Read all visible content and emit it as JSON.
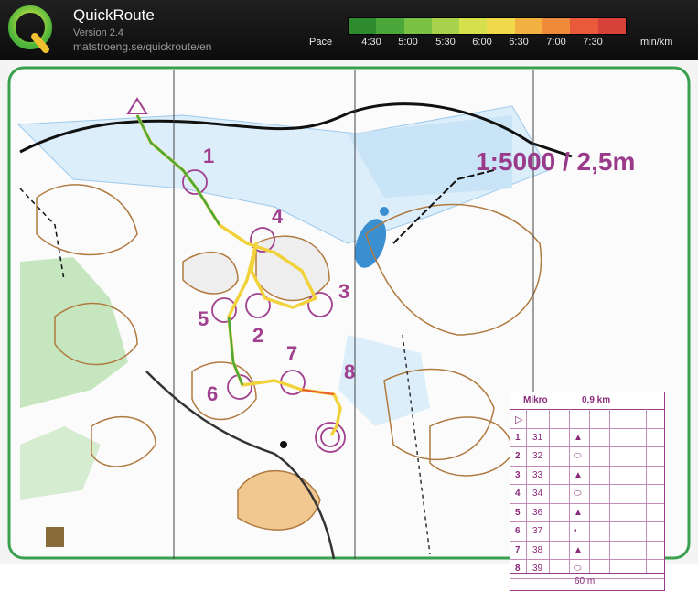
{
  "app": {
    "title": "QuickRoute",
    "version": "Version 2.4",
    "url": "matstroeng.se/quickroute/en"
  },
  "pace_legend": {
    "label": "Pace",
    "unit": "min/km",
    "ticks": [
      "4:30",
      "5:00",
      "5:30",
      "6:00",
      "6:30",
      "7:00",
      "7:30"
    ],
    "gradient_colors": [
      "#2e8b2e",
      "#4aa83a",
      "#79c244",
      "#a8d24c",
      "#d6e04c",
      "#f0d94a",
      "#f2b140",
      "#ef8a3a",
      "#e85a3a",
      "#d8403a"
    ]
  },
  "map": {
    "scale_text": "1:5000 / 2,5m",
    "controls": [
      "1",
      "2",
      "3",
      "4",
      "5",
      "6",
      "7",
      "8"
    ]
  },
  "control_description": {
    "event": "Mikro",
    "length": "0,9 km",
    "rows": [
      {
        "num": "1",
        "code": "31",
        "symbol": "▲"
      },
      {
        "num": "2",
        "code": "32",
        "symbol": "⬭"
      },
      {
        "num": "3",
        "code": "33",
        "symbol": "▲"
      },
      {
        "num": "4",
        "code": "34",
        "symbol": "⬭"
      },
      {
        "num": "5",
        "code": "36",
        "symbol": "▲"
      },
      {
        "num": "6",
        "code": "37",
        "symbol": "•"
      },
      {
        "num": "7",
        "code": "38",
        "symbol": "▲"
      },
      {
        "num": "8",
        "code": "39",
        "symbol": "⬭"
      }
    ],
    "finish_distance": "60 m"
  }
}
